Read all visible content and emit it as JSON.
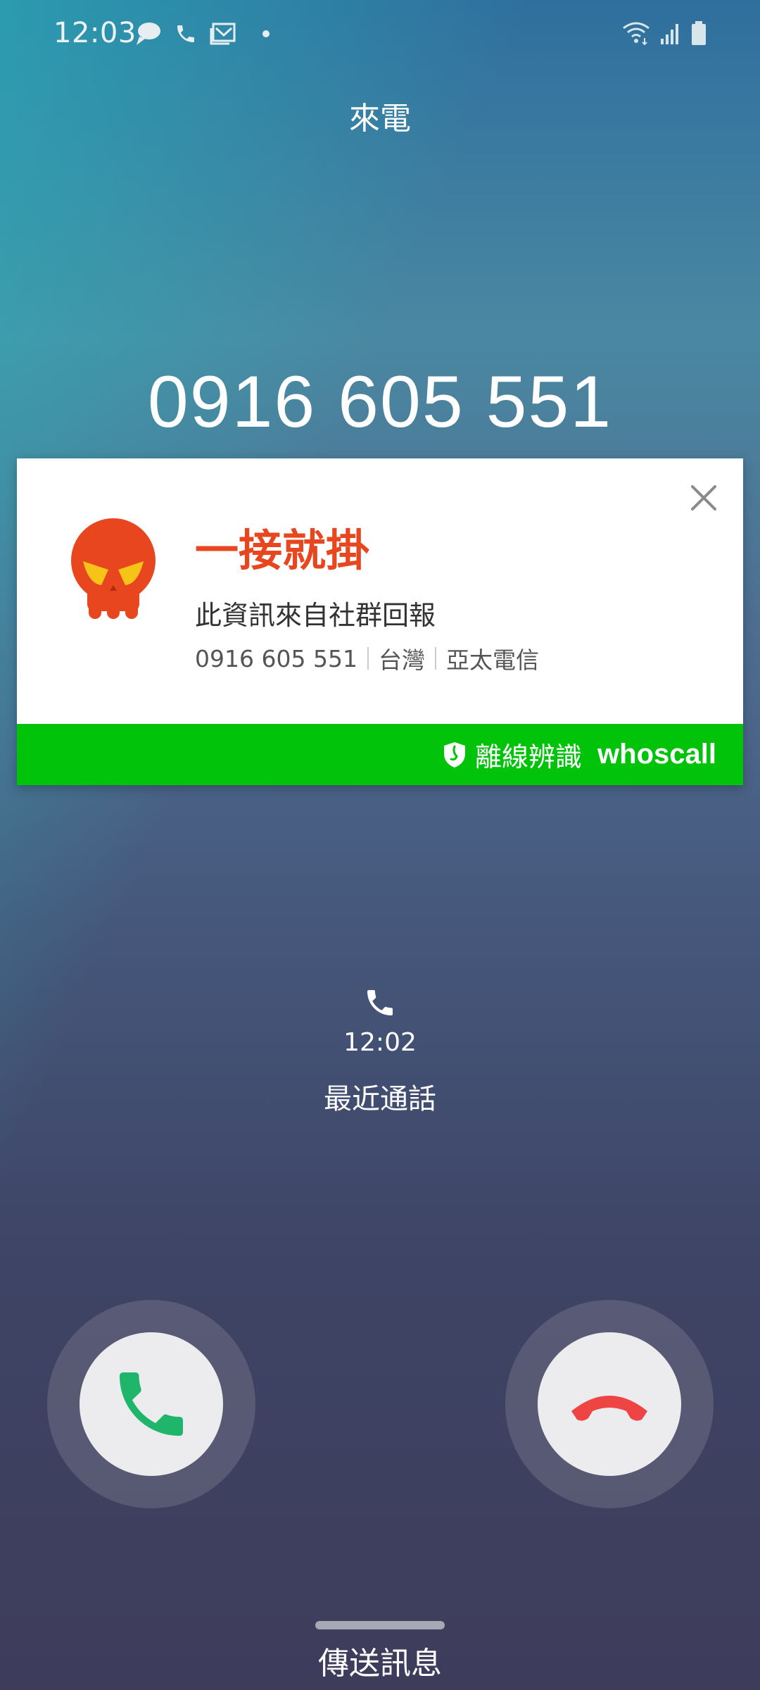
{
  "status_bar": {
    "time": "12:03",
    "left_icons": [
      "chat-bubble-icon",
      "phone-icon",
      "mail-icon",
      "dot-icon"
    ],
    "right_icons": [
      "wifi-icon",
      "signal-icon",
      "battery-icon"
    ]
  },
  "call": {
    "status": "來電",
    "number": "0916 605 551"
  },
  "card": {
    "tag": "一接就掛",
    "source": "此資訊來自社群回報",
    "number": "0916 605 551",
    "region": "台灣",
    "carrier": "亞太電信",
    "offline_label": "離線辨識",
    "brand": "whoscall",
    "colors": {
      "tag": "#e8461e",
      "footer": "#00c30a"
    }
  },
  "recent": {
    "time": "12:02",
    "label": "最近通話"
  },
  "actions": {
    "accept_icon": "phone-accept-icon",
    "decline_icon": "phone-decline-icon",
    "send_message": "傳送訊息",
    "colors": {
      "accept": "#1fb56a",
      "decline": "#ef4444"
    }
  }
}
